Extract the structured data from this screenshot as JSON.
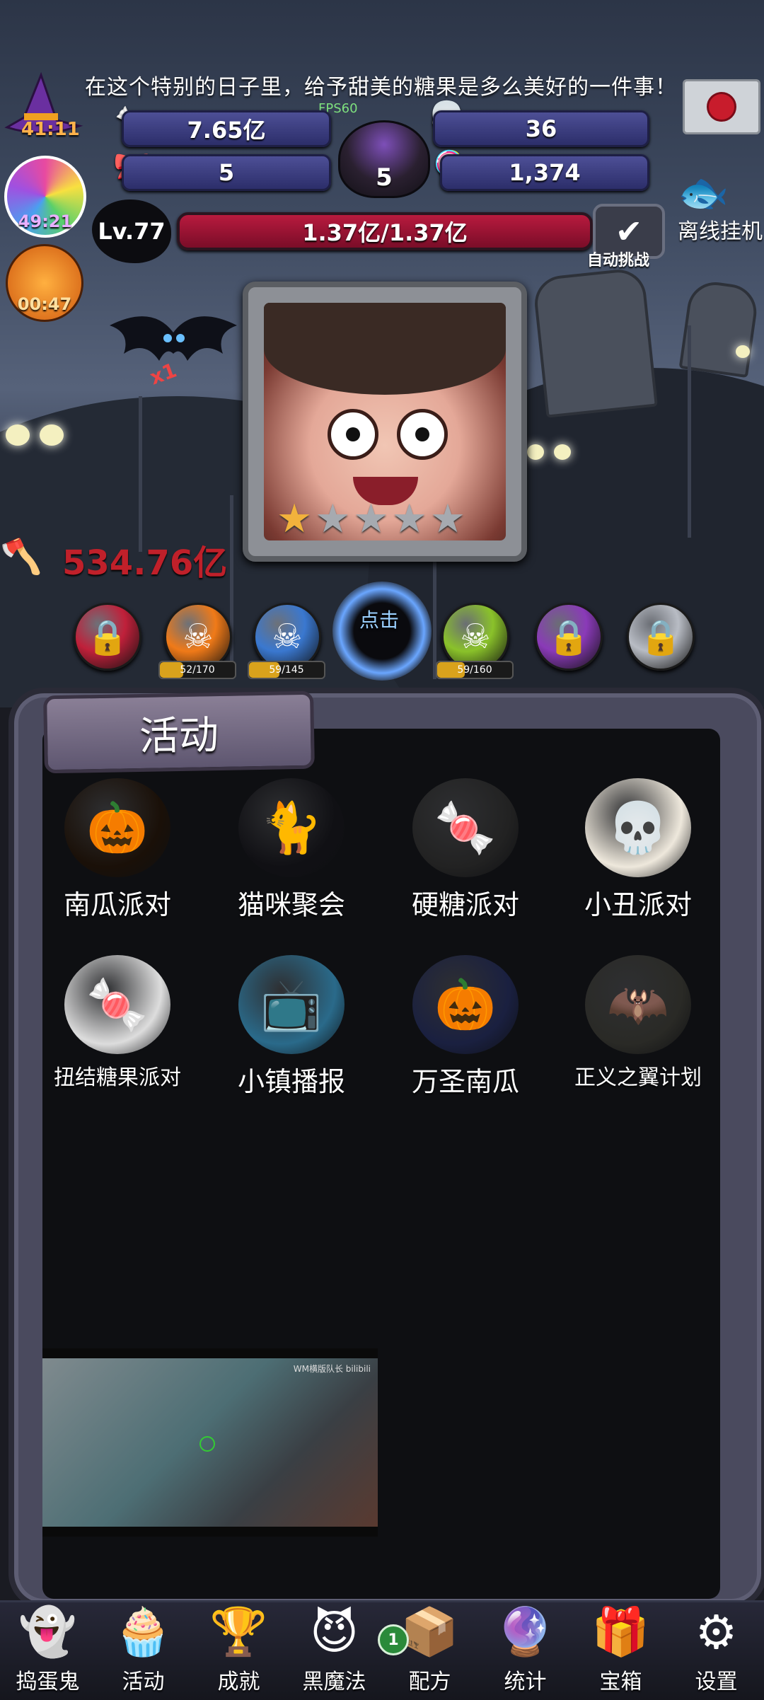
{
  "hud": {
    "banner": "在这个特别的日子里，给予甜美的糖果是多么美好的一件事！",
    "fps": "FPS60",
    "candy_total": "7.65亿",
    "skull_count": "36",
    "bow_count": "5",
    "candy_corn": "1,374",
    "cauldron_count": "5",
    "hat_timer": "41:11",
    "lollipop_timer": "49:21",
    "pumpkin_timer": "00:47"
  },
  "level": {
    "label": "Lv.77",
    "hp": "1.37亿/1.37亿",
    "auto_label": "自动挑战",
    "offline_label": "离线挂机"
  },
  "boss": {
    "stars_total": 5,
    "stars_filled": 1,
    "damage": "534.76亿",
    "bat_tag": "x1"
  },
  "monsters": [
    {
      "color": "#c0203a",
      "locked": true,
      "progress": ""
    },
    {
      "color": "#f07a18",
      "locked": false,
      "progress": "52/170",
      "fill": 0.31
    },
    {
      "color": "#3a78d0",
      "locked": false,
      "progress": "59/145",
      "fill": 0.41
    },
    {
      "color": "#111",
      "locked": false,
      "progress": "",
      "click": "点击"
    },
    {
      "color": "#8ac22a",
      "locked": false,
      "progress": "59/160",
      "fill": 0.37
    },
    {
      "color": "#8a3ab8",
      "locked": true,
      "progress": ""
    },
    {
      "color": "#b8bcc4",
      "locked": true,
      "progress": ""
    }
  ],
  "panel": {
    "title": "活动",
    "activities": [
      {
        "label": "南瓜派对",
        "icon": "pumpkin-lollipop-icon",
        "glyph": "🎃"
      },
      {
        "label": "猫咪聚会",
        "icon": "black-cat-icon",
        "glyph": "🐈"
      },
      {
        "label": "硬糖派对",
        "icon": "hard-candy-icon",
        "glyph": "🍬"
      },
      {
        "label": "小丑派对",
        "icon": "skull-lollipop-icon",
        "glyph": "💀"
      },
      {
        "label": "扭结糖果派对",
        "icon": "striped-candy-icon",
        "glyph": "🍬"
      },
      {
        "label": "小镇播报",
        "icon": "tv-icon",
        "glyph": "📺"
      },
      {
        "label": "万圣南瓜",
        "icon": "jack-o-lantern-icon",
        "glyph": "🎃"
      },
      {
        "label": "正义之翼计划",
        "icon": "winged-jar-icon",
        "glyph": "🦇"
      }
    ],
    "video_watermark": "WM横版队长 bilibili"
  },
  "nav": {
    "items": [
      {
        "label": "捣蛋鬼",
        "glyph": "👻"
      },
      {
        "label": "活动",
        "glyph": "🧁"
      },
      {
        "label": "成就",
        "glyph": "🏆"
      },
      {
        "label": "黑魔法",
        "glyph": "😈"
      },
      {
        "label": "配方",
        "glyph": "📦"
      },
      {
        "label": "统计",
        "glyph": "🔮"
      },
      {
        "label": "宝箱",
        "glyph": "🎁"
      },
      {
        "label": "设置",
        "glyph": "⚙"
      }
    ],
    "recipe_badge": "1"
  },
  "colors": {
    "hp_bar": "#b81a3e",
    "panel": "#4a4a5e",
    "stat_pill": "#4d4f96"
  }
}
